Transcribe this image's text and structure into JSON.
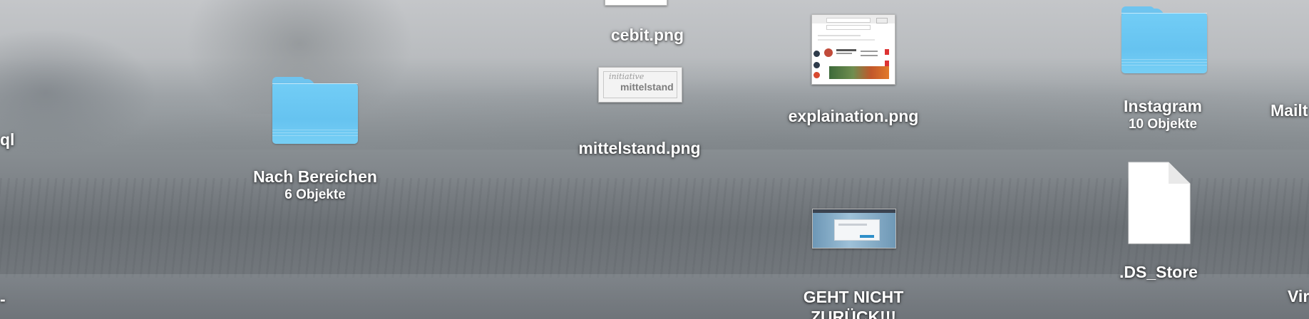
{
  "desktop": {
    "items": {
      "partial_left_ql": {
        "label": "ql"
      },
      "nach_bereichen": {
        "label": "Nach Bereichen",
        "sub": "6 Objekte"
      },
      "cebit": {
        "label": "cebit.png"
      },
      "mittelstand": {
        "label": "mittelstand.png",
        "thumb_text_top": "initiative",
        "thumb_text_bottom": "mittelstand"
      },
      "explaination": {
        "label": "explaination.png"
      },
      "geht_nicht": {
        "label_line1": "GEHT NICHT",
        "label_line2": "ZURÜCK!!!"
      },
      "instagram": {
        "label": "Instagram",
        "sub": "10 Objekte"
      },
      "ds_store": {
        "label": ".DS_Store"
      },
      "partial_mailt": {
        "label": "Mailt"
      },
      "partial_vir": {
        "label": "Vir"
      },
      "partial_left_dash": {
        "label": "-"
      }
    }
  },
  "colors": {
    "folder": "#6ec4ef",
    "label": "#ffffff"
  }
}
